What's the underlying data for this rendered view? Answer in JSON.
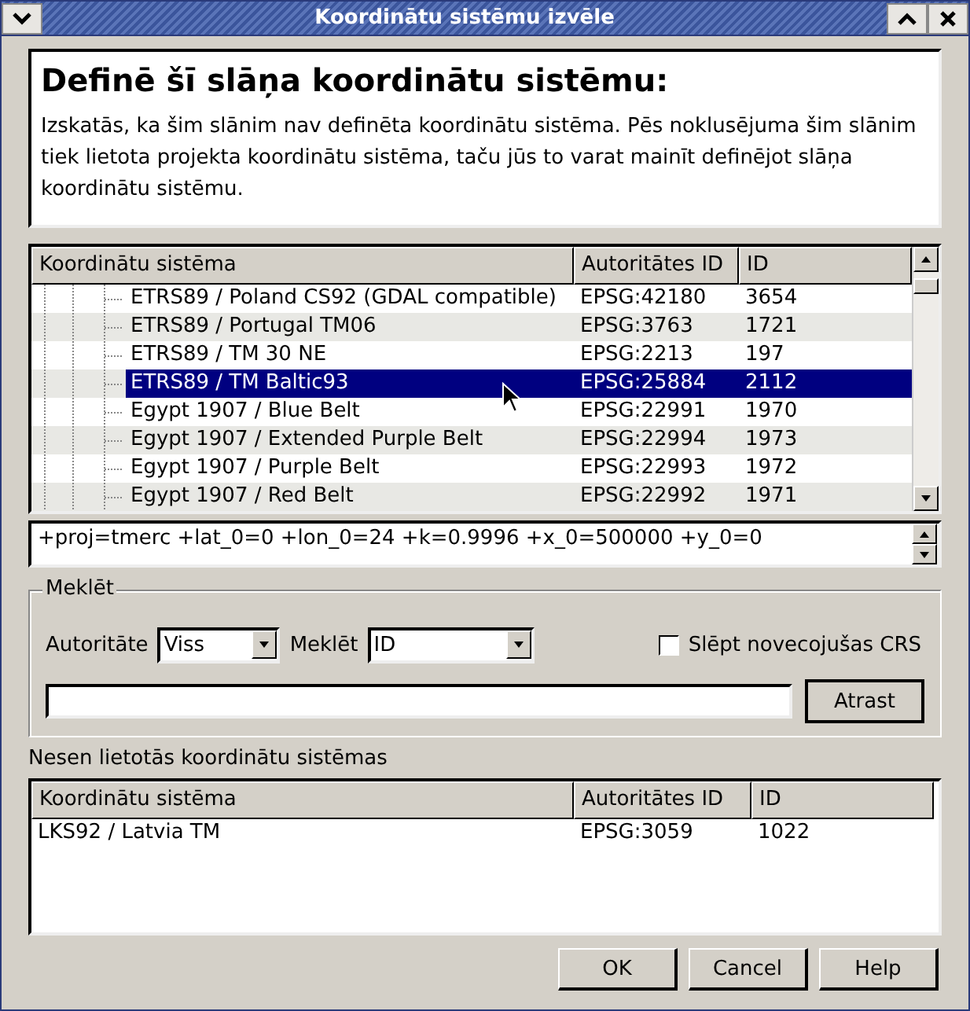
{
  "window": {
    "title": "Koordinātu sistēmu izvēle"
  },
  "header": {
    "title": "Definē šī slāņa koordinātu sistēmu:",
    "text": "Izskatās, ka šim slānim nav definēta koordinātu sistēma. Pēs noklusējuma šim slānim tiek lietota projekta koordinātu sistēma, taču jūs to varat mainīt definējot slāņa koordinātu sistēmu."
  },
  "crs_table": {
    "columns": [
      "Koordinātu sistēma",
      "Autoritātes ID",
      "ID"
    ],
    "rows": [
      {
        "name": "ETRS89 / Poland CS92 (GDAL compatible)",
        "authority_id": "EPSG:42180",
        "id": "3654",
        "selected": false
      },
      {
        "name": "ETRS89 / Portugal TM06",
        "authority_id": "EPSG:3763",
        "id": "1721",
        "selected": false
      },
      {
        "name": "ETRS89 / TM 30 NE",
        "authority_id": "EPSG:2213",
        "id": "197",
        "selected": false
      },
      {
        "name": "ETRS89 / TM Baltic93",
        "authority_id": "EPSG:25884",
        "id": "2112",
        "selected": true
      },
      {
        "name": "Egypt 1907 / Blue Belt",
        "authority_id": "EPSG:22991",
        "id": "1970",
        "selected": false
      },
      {
        "name": "Egypt 1907 / Extended Purple Belt",
        "authority_id": "EPSG:22994",
        "id": "1973",
        "selected": false
      },
      {
        "name": "Egypt 1907 / Purple Belt",
        "authority_id": "EPSG:22993",
        "id": "1972",
        "selected": false
      },
      {
        "name": "Egypt 1907 / Red Belt",
        "authority_id": "EPSG:22992",
        "id": "1971",
        "selected": false
      }
    ]
  },
  "proj_string": "+proj=tmerc +lat_0=0 +lon_0=24 +k=0.9996 +x_0=500000 +y_0=0",
  "search": {
    "title": "Meklēt",
    "authority_label": "Autoritāte",
    "authority_value": "Viss",
    "search_label": "Meklēt",
    "search_value": "ID",
    "hide_deprecated": {
      "label": "Slēpt novecojušas CRS",
      "checked": false
    },
    "find_button": "Atrast"
  },
  "recent": {
    "title": "Nesen lietotās koordinātu sistēmas",
    "columns": [
      "Koordinātu sistēma",
      "Autoritātes ID",
      "ID"
    ],
    "rows": [
      {
        "name": "LKS92 / Latvia TM",
        "authority_id": "EPSG:3059",
        "id": "1022"
      }
    ]
  },
  "buttons": [
    "OK",
    "Cancel",
    "Help"
  ]
}
